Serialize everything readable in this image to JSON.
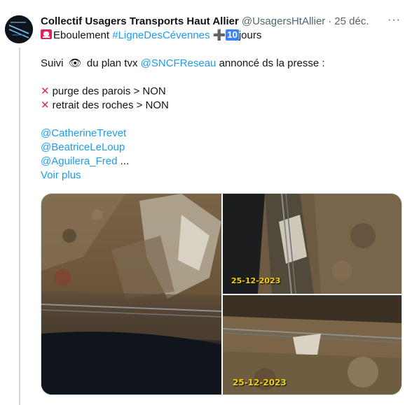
{
  "tweet": {
    "display_name": "Collectif Usagers Transports Haut Allier",
    "handle": "@UsagersHtAllier",
    "separator": "·",
    "date": "25 déc.",
    "more_label": "···",
    "line1_text": "Eboulement",
    "line1_hashtag": "#LigneDesCévennes",
    "line1_plus": "➕",
    "line1_ten": "10",
    "line1_suffix": "jours",
    "line2_prefix": "Suivi",
    "line2_eye": "👁",
    "line2_middle": "du plan tvx",
    "line2_mention": "@SNCFReseau",
    "line2_suffix": "annoncé ds la presse :",
    "cross_glyph": "✕",
    "item1": "purge des parois > NON",
    "item2": "retrait des roches > NON",
    "mention1": "@CatherineTrevet",
    "mention2": "@BeatriceLeLoup",
    "mention3": "@Aguilera_Fred",
    "ellipsis": "...",
    "see_more": "Voir plus"
  },
  "media": {
    "stamp_b": "25-12-2023",
    "stamp_c": "25-12-2023"
  },
  "colors": {
    "link": "#1d9bf0",
    "secondary": "#536471",
    "cross": "#e0245e",
    "stamp": "#f5d000"
  }
}
